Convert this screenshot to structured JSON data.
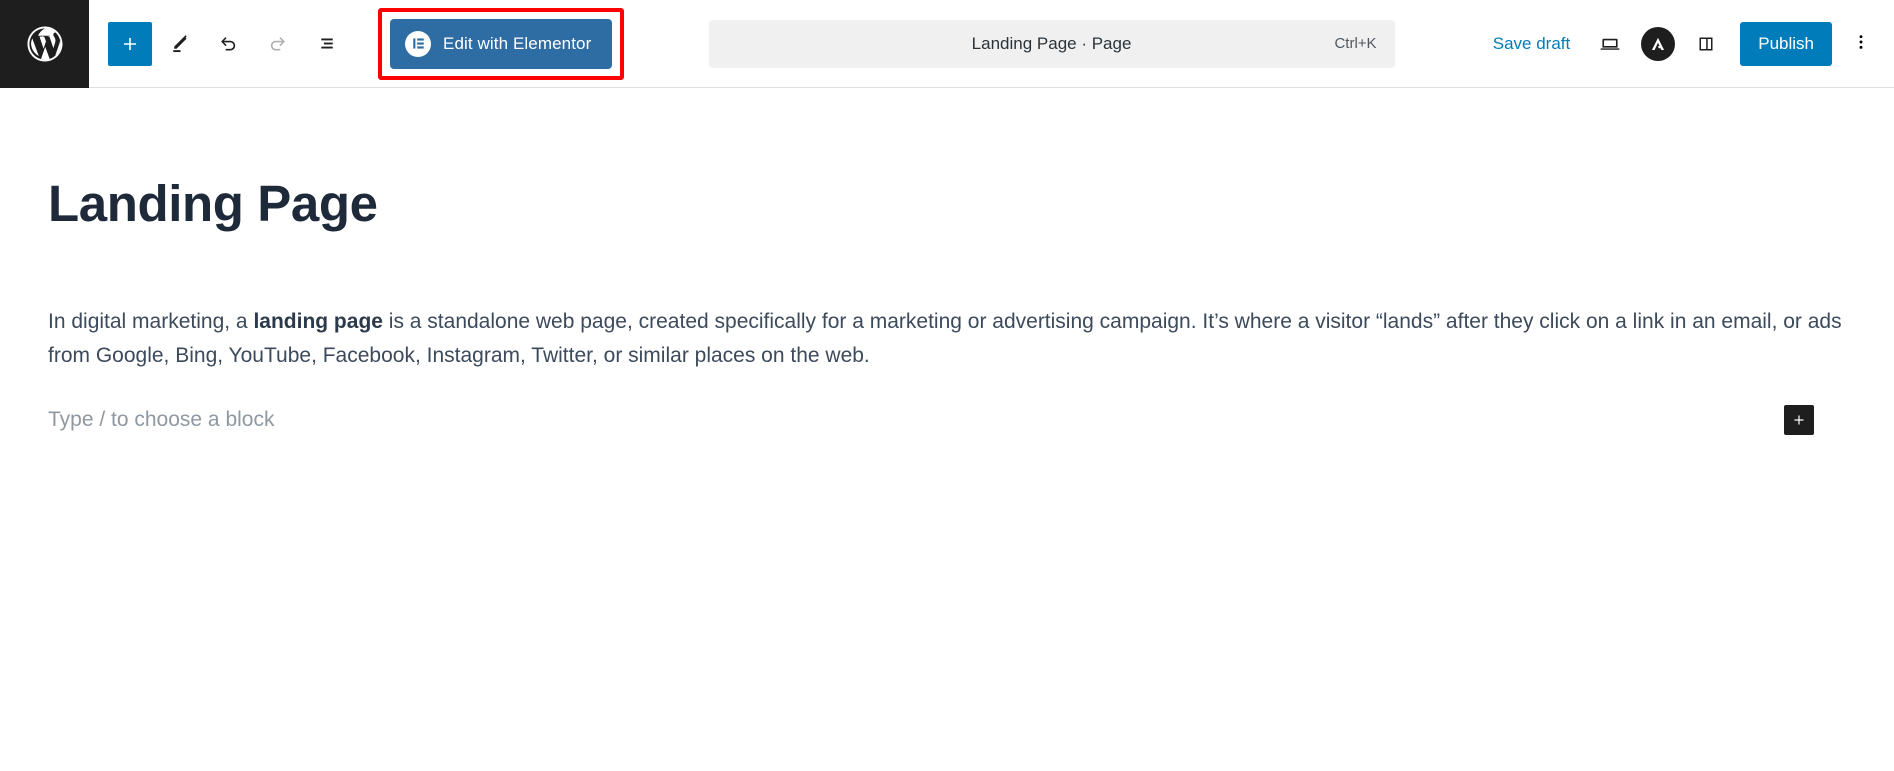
{
  "header": {
    "wp_logo_icon": "wordpress-logo-icon",
    "tools": [
      {
        "name": "add-block-button",
        "icon": "plus-icon",
        "label": "Add block"
      },
      {
        "name": "tools-edit-button",
        "icon": "pencil-icon",
        "label": "Edit"
      },
      {
        "name": "undo-button",
        "icon": "undo-arrow-icon",
        "label": "Undo"
      },
      {
        "name": "redo-button",
        "icon": "redo-arrow-icon",
        "label": "Redo"
      },
      {
        "name": "document-overview-button",
        "icon": "list-view-icon",
        "label": "Document Overview"
      }
    ],
    "elementor_button": {
      "label": "Edit with Elementor",
      "icon": "elementor-logo-icon",
      "background": "#2e6da4",
      "highlight_color": "#ff0000"
    },
    "command_bar": {
      "title": "Landing Page · Page",
      "shortcut": "Ctrl+K",
      "background": "#f0f0f0"
    },
    "save_draft_label": "Save draft",
    "preview_icon": "laptop-preview-icon",
    "astra_icon": "astra-logo-icon",
    "settings_sidebar_icon": "sidebar-panel-icon",
    "publish_label": "Publish",
    "publish_color": "#007cba",
    "options_icon": "kebab-menu-icon"
  },
  "content": {
    "title": "Landing Page",
    "paragraph_lead": "In digital marketing, a ",
    "paragraph_bold": "landing page",
    "paragraph_rest": " is a standalone web page, created specifically for a marketing or advertising campaign. It’s where a visitor “lands” after they click on a link in an email, or ads from Google, Bing, YouTube, Facebook, Instagram, Twitter, or similar places on the web.",
    "block_placeholder": "Type / to choose a block",
    "appender_icon": "plus-icon"
  }
}
